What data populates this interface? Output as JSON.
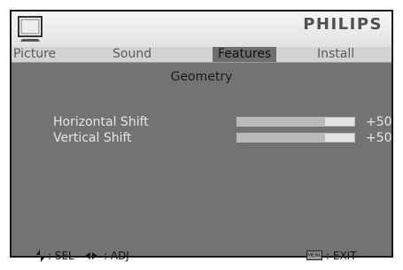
{
  "header": {
    "brand": "PHILIPS",
    "icon": "tv-icon"
  },
  "tabs": [
    {
      "label": "Picture",
      "active": false
    },
    {
      "label": "Sound",
      "active": false
    },
    {
      "label": "Features",
      "active": true
    },
    {
      "label": "Install",
      "active": false
    }
  ],
  "section": {
    "title": "Geometry"
  },
  "settings": [
    {
      "label": "Horizontal Shift",
      "value": "+50",
      "level": 0.75
    },
    {
      "label": "Vertical Shift",
      "value": "+50",
      "level": 0.75
    }
  ],
  "footer": {
    "select_label": ": SEL",
    "adjust_label": ": ADJ",
    "menu_key": "MENU",
    "exit_label": ": EXIT"
  },
  "colors": {
    "osd_background": "#737373",
    "active_tab": "#6e6e6e",
    "bar_track": "#e4e4e4",
    "bar_fill": "#b9b9b9"
  }
}
